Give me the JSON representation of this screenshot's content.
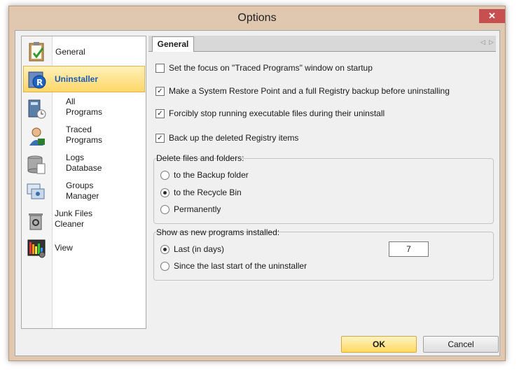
{
  "window": {
    "title": "Options",
    "close_glyph": "✕"
  },
  "sidebar": {
    "items": [
      {
        "label": "General",
        "icon": "clipboard-check-icon"
      },
      {
        "label": "Uninstaller",
        "icon": "uninstaller-r-icon",
        "selected": true
      },
      {
        "label": "All\nPrograms",
        "icon": "all-programs-icon"
      },
      {
        "label": "Traced\nPrograms",
        "icon": "traced-programs-icon"
      },
      {
        "label": "Logs\nDatabase",
        "icon": "logs-database-icon"
      },
      {
        "label": "Groups\nManager",
        "icon": "groups-manager-icon"
      },
      {
        "label": "Junk Files\nCleaner",
        "icon": "junk-files-icon"
      },
      {
        "label": "View",
        "icon": "view-grid-icon"
      }
    ]
  },
  "tabs": {
    "active": "General",
    "prev_glyph": "◁",
    "next_glyph": "▷"
  },
  "options": {
    "focus_traced": {
      "label": "Set the focus on \"Traced Programs\" window on startup",
      "checked": false
    },
    "restore_point": {
      "label": "Make a System Restore Point and a full Registry backup before uninstalling",
      "checked": true
    },
    "stop_running": {
      "label": "Forcibly stop running executable files during their uninstall",
      "checked": true
    },
    "backup_registry": {
      "label": "Back up the deleted Registry items",
      "checked": true
    }
  },
  "delete_group": {
    "title": "Delete files and folders:",
    "options": [
      {
        "label": "to the Backup folder",
        "selected": false
      },
      {
        "label": "to the Recycle Bin",
        "selected": true
      },
      {
        "label": "Permanently",
        "selected": false
      }
    ]
  },
  "new_programs_group": {
    "title": "Show as new programs installed:",
    "last_days_label": "Last (in days)",
    "last_days_value": "7",
    "since_label": "Since the last start of the uninstaller",
    "selected": "last_days"
  },
  "buttons": {
    "ok": "OK",
    "cancel": "Cancel"
  },
  "colors": {
    "accent_selected": "#ffd768",
    "close_red": "#c74f4f",
    "selected_text": "#1c59b8"
  }
}
